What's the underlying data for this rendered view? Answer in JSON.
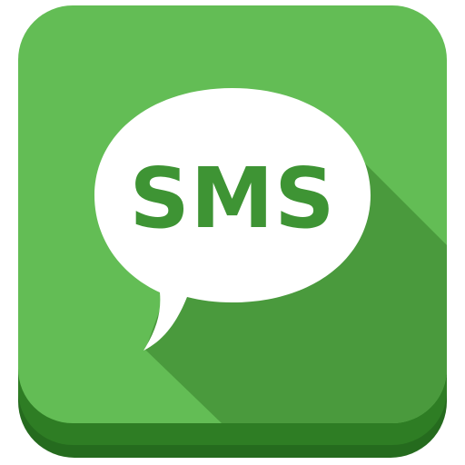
{
  "icon": {
    "name": "sms-message-icon",
    "label": "SMS"
  },
  "colors": {
    "tile_main": "#63BD55",
    "tile_base": "#2E7D24",
    "tile_base_bottom": "#256B1E",
    "long_shadow": "#4A9A3D",
    "bubble": "#FFFFFF",
    "label_text": "#3E9434",
    "page_background": "#FFFFFF"
  }
}
